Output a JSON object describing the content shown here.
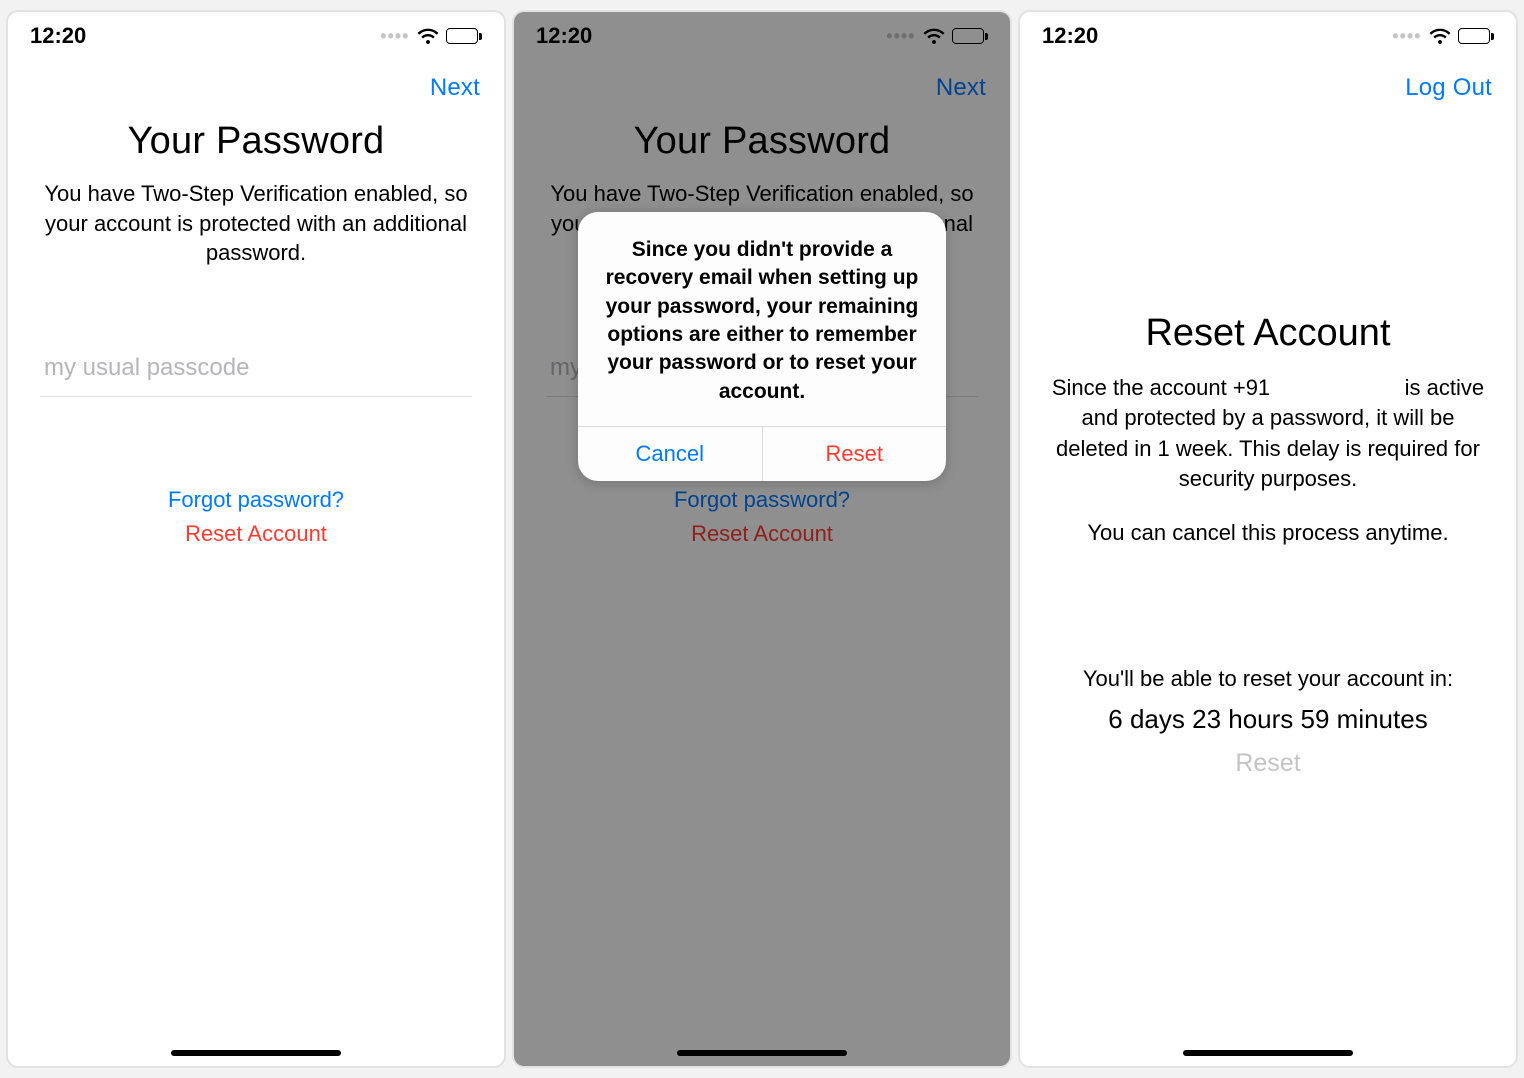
{
  "status": {
    "time": "12:20"
  },
  "screen1": {
    "nav_next": "Next",
    "title": "Your Password",
    "subtitle": "You have Two-Step Verification enabled, so your account is protected with an additional password.",
    "placeholder": "my usual passcode",
    "forgot": "Forgot password?",
    "reset": "Reset Account"
  },
  "screen2": {
    "nav_next": "Next",
    "title": "Your Password",
    "subtitle": "You have Two-Step Verification enabled, so your account is protected with an additional password.",
    "forgot": "Forgot password?",
    "reset": "Reset Account",
    "alert": {
      "message": "Since you didn't provide a recovery email when setting up your password, your remaining options are either to remember your password or to reset your account.",
      "cancel": "Cancel",
      "reset": "Reset"
    }
  },
  "screen3": {
    "nav_logout": "Log Out",
    "title": "Reset Account",
    "desc_pre": "Since the account +91",
    "desc_post": "is active and protected by a password, it will be deleted in 1 week. This delay is required for security purposes.",
    "cancel_note": "You can cancel this process anytime.",
    "countdown_label": "You'll be able to reset your account in:",
    "countdown_value": "6 days 23 hours 59 minutes",
    "reset_btn": "Reset"
  }
}
